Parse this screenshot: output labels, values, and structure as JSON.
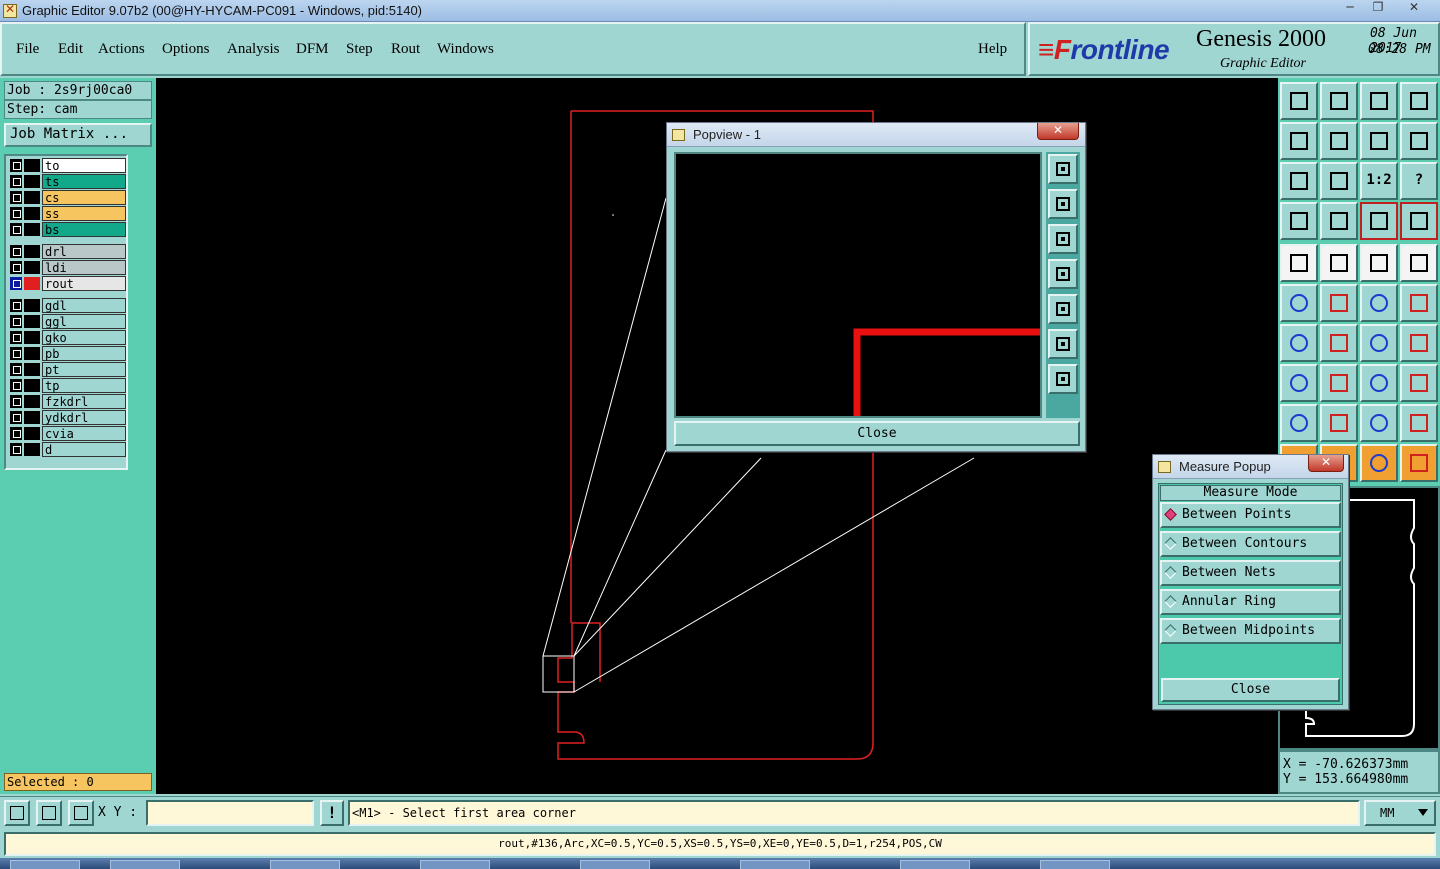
{
  "window": {
    "title": "Graphic Editor 9.07b2 (00@HY-HYCAM-PC091 - Windows, pid:5140)",
    "minimize": "─",
    "restore": "❐",
    "close": "✕"
  },
  "menubar": {
    "items": [
      "File",
      "Edit",
      "Actions",
      "Options",
      "Analysis",
      "DFM",
      "Step",
      "Rout",
      "Windows"
    ],
    "help": "Help"
  },
  "brand": {
    "logo_f": "≡F",
    "logo_rest": "rontline",
    "product": "Genesis 2000",
    "subtitle": "Graphic Editor",
    "date": "08 Jun 2017",
    "time": "08:28 PM"
  },
  "job": {
    "job_label": "Job : 2s9rj00ca0",
    "step_label": "Step: cam",
    "matrix_button": "Job Matrix ..."
  },
  "layers": {
    "group1": [
      {
        "name": "to",
        "color": "#ffffff"
      },
      {
        "name": "ts",
        "color": "#12a88a"
      },
      {
        "name": "cs",
        "color": "#f7c560"
      },
      {
        "name": "ss",
        "color": "#f7c560"
      },
      {
        "name": "bs",
        "color": "#12a88a"
      }
    ],
    "group2": [
      {
        "name": "drl",
        "color": "#b9c7c9"
      },
      {
        "name": "ldi",
        "color": "#b9c7c9"
      },
      {
        "name": "rout",
        "color": "#e6e6e6",
        "active": true
      }
    ],
    "group3": [
      {
        "name": "gdl",
        "color": "#9fd6d2"
      },
      {
        "name": "ggl",
        "color": "#9fd6d2"
      },
      {
        "name": "gko",
        "color": "#9fd6d2"
      },
      {
        "name": "pb",
        "color": "#9fd6d2"
      },
      {
        "name": "pt",
        "color": "#9fd6d2"
      },
      {
        "name": "tp",
        "color": "#9fd6d2"
      },
      {
        "name": "fzkdrl",
        "color": "#9fd6d2"
      },
      {
        "name": "ydkdrl",
        "color": "#9fd6d2"
      },
      {
        "name": "cvia",
        "color": "#9fd6d2"
      },
      {
        "name": "d",
        "color": "#9fd6d2"
      }
    ]
  },
  "selected": "Selected : 0",
  "popview": {
    "title": "Popview - 1",
    "close_label": "Close",
    "close_x": "✕"
  },
  "measure": {
    "title": "Measure Popup",
    "header": "Measure Mode",
    "modes": [
      "Between Points",
      "Between Contours",
      "Between Nets",
      "Annular Ring",
      "Between Midpoints"
    ],
    "selected_mode": "Between Points",
    "close_label": "Close",
    "close_x": "✕"
  },
  "tools": {
    "text_buttons": [
      "1:2",
      "?"
    ]
  },
  "coords": {
    "x": "X = -70.626373mm",
    "y": "Y = 153.664980mm"
  },
  "statusbar": {
    "xy_label": "X Y :",
    "xy_value": "",
    "bang": "!",
    "prompt": "<M1> - Select first area corner",
    "units": "MM"
  },
  "info": "rout,#136,Arc,XC=0.5,YC=0.5,XS=0.5,YS=0,XE=0,YE=0.5,D=1,r254,POS,CW",
  "colors": {
    "rout": "#e02020",
    "panel": "#9fd6d2",
    "accent": "#5bcdb0",
    "selected": "#f7c560"
  }
}
